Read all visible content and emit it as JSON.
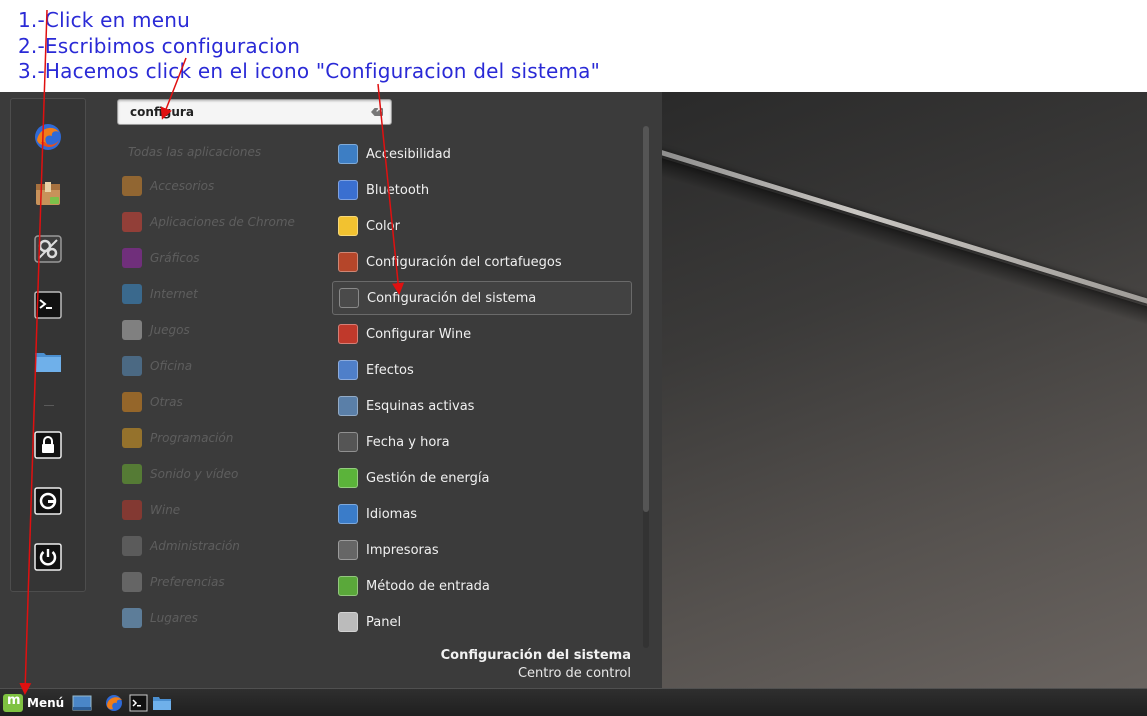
{
  "annotation": {
    "lines": [
      "1.-Click en menu",
      "2.-Escribimos configuracion",
      "3.-Hacemos click en el icono \"Configuracion del sistema\""
    ],
    "color": "#2a2ad6",
    "arrow_color": "#e01010"
  },
  "favorites": [
    {
      "icon": "firefox-icon"
    },
    {
      "icon": "package-icon"
    },
    {
      "icon": "system-settings-icon"
    },
    {
      "icon": "terminal-icon"
    },
    {
      "icon": "folder-icon"
    },
    {
      "icon": "lock-screen-icon"
    },
    {
      "icon": "logout-icon"
    },
    {
      "icon": "power-icon"
    }
  ],
  "search": {
    "value": "configura"
  },
  "categories": {
    "header": "Todas las aplicaciones",
    "items": [
      {
        "label": "Accesorios",
        "icon": "accessories-icon",
        "color": "#d98b2b"
      },
      {
        "label": "Aplicaciones de Chrome",
        "icon": "chrome-icon",
        "color": "#db4437"
      },
      {
        "label": "Gráficos",
        "icon": "graphics-icon",
        "color": "#9c27b0"
      },
      {
        "label": "Internet",
        "icon": "internet-icon",
        "color": "#3b8fd1"
      },
      {
        "label": "Juegos",
        "icon": "games-icon",
        "color": "#b9b9b9"
      },
      {
        "label": "Oficina",
        "icon": "office-icon",
        "color": "#5a8fc0"
      },
      {
        "label": "Otras",
        "icon": "other-icon",
        "color": "#e08a1e"
      },
      {
        "label": "Programación",
        "icon": "programming-icon",
        "color": "#e0a020"
      },
      {
        "label": "Sonido y vídeo",
        "icon": "sound-video-icon",
        "color": "#6bb031"
      },
      {
        "label": "Wine",
        "icon": "wine-icon",
        "color": "#c0392b"
      },
      {
        "label": "Administración",
        "icon": "administration-icon",
        "color": "#777777"
      },
      {
        "label": "Preferencias",
        "icon": "preferences-icon",
        "color": "#888888"
      },
      {
        "label": "Lugares",
        "icon": "places-icon",
        "color": "#7ab4e8"
      }
    ]
  },
  "apps": {
    "selected_index": 4,
    "items": [
      {
        "label": "Accesibilidad",
        "icon": "accessibility-icon",
        "color": "#3d7ec4"
      },
      {
        "label": "Bluetooth",
        "icon": "bluetooth-icon",
        "color": "#3a6fd0"
      },
      {
        "label": "Color",
        "icon": "color-icon",
        "color": "#f2c230"
      },
      {
        "label": "Configuración del cortafuegos",
        "icon": "firewall-icon",
        "color": "#b5462a"
      },
      {
        "label": "Configuración del sistema",
        "icon": "system-settings-icon",
        "color": "#4a4a4a"
      },
      {
        "label": "Configurar Wine",
        "icon": "wine-config-icon",
        "color": "#c0392b"
      },
      {
        "label": "Efectos",
        "icon": "effects-icon",
        "color": "#4f7fc9"
      },
      {
        "label": "Esquinas activas",
        "icon": "hot-corners-icon",
        "color": "#5a7fa8"
      },
      {
        "label": "Fecha y hora",
        "icon": "date-time-icon",
        "color": "#555555"
      },
      {
        "label": "Gestión de energía",
        "icon": "power-management-icon",
        "color": "#5bb33a"
      },
      {
        "label": "Idiomas",
        "icon": "languages-icon",
        "color": "#3a7cc9"
      },
      {
        "label": "Impresoras",
        "icon": "printers-icon",
        "color": "#666666"
      },
      {
        "label": "Método de entrada",
        "icon": "input-method-icon",
        "color": "#5aa83a"
      },
      {
        "label": "Panel",
        "icon": "panel-icon",
        "color": "#bbbbbb"
      }
    ]
  },
  "description": {
    "title": "Configuración del sistema",
    "subtitle": "Centro de control"
  },
  "taskbar": {
    "menu_label": "Menú",
    "launchers": [
      {
        "icon": "show-desktop-icon"
      },
      {
        "icon": "firefox-icon"
      },
      {
        "icon": "terminal-icon"
      },
      {
        "icon": "folder-icon"
      }
    ]
  }
}
